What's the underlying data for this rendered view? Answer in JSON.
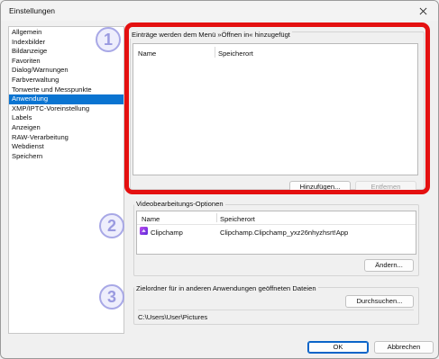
{
  "window": {
    "title": "Einstellungen"
  },
  "colors": {
    "accent": "#0a74d1",
    "highlight": "#e41010",
    "badge": "#a8a8e6"
  },
  "sidebar": {
    "items": [
      {
        "label": "Allgemein"
      },
      {
        "label": "Indexbilder"
      },
      {
        "label": "Bildanzeige"
      },
      {
        "label": "Favoriten"
      },
      {
        "label": "Dialog/Warnungen"
      },
      {
        "label": "Farbverwaltung"
      },
      {
        "label": "Tonwerte und Messpunkte"
      },
      {
        "label": "Anwendung",
        "selected": true
      },
      {
        "label": "XMP/IPTC-Voreinstellung"
      },
      {
        "label": "Labels"
      },
      {
        "label": "Anzeigen"
      },
      {
        "label": "RAW-Verarbeitung"
      },
      {
        "label": "Webdienst"
      },
      {
        "label": "Speichern"
      }
    ]
  },
  "open_in_menu": {
    "badge": "1",
    "title": "Einträge werden dem Menü »Öffnen in« hinzugefügt",
    "columns": [
      "Name",
      "Speicherort"
    ],
    "add_button": "Hinzufügen...",
    "remove_button": "Entfernen"
  },
  "video_options": {
    "badge": "2",
    "title": "Videobearbeitungs-Optionen",
    "columns": [
      "Name",
      "Speicherort"
    ],
    "rows": [
      {
        "name": "Clipchamp",
        "location": "Clipchamp.Clipchamp_yxz26nhyzhsrt!App",
        "icon": "clipchamp-icon"
      }
    ],
    "change_button": "Ändern..."
  },
  "target_folder": {
    "badge": "3",
    "title": "Zielordner für in anderen Anwendungen geöffneten Dateien",
    "browse_button": "Durchsuchen...",
    "path": "C:\\Users\\User\\Pictures"
  },
  "footer": {
    "ok_button": "OK",
    "cancel_button": "Abbrechen"
  }
}
